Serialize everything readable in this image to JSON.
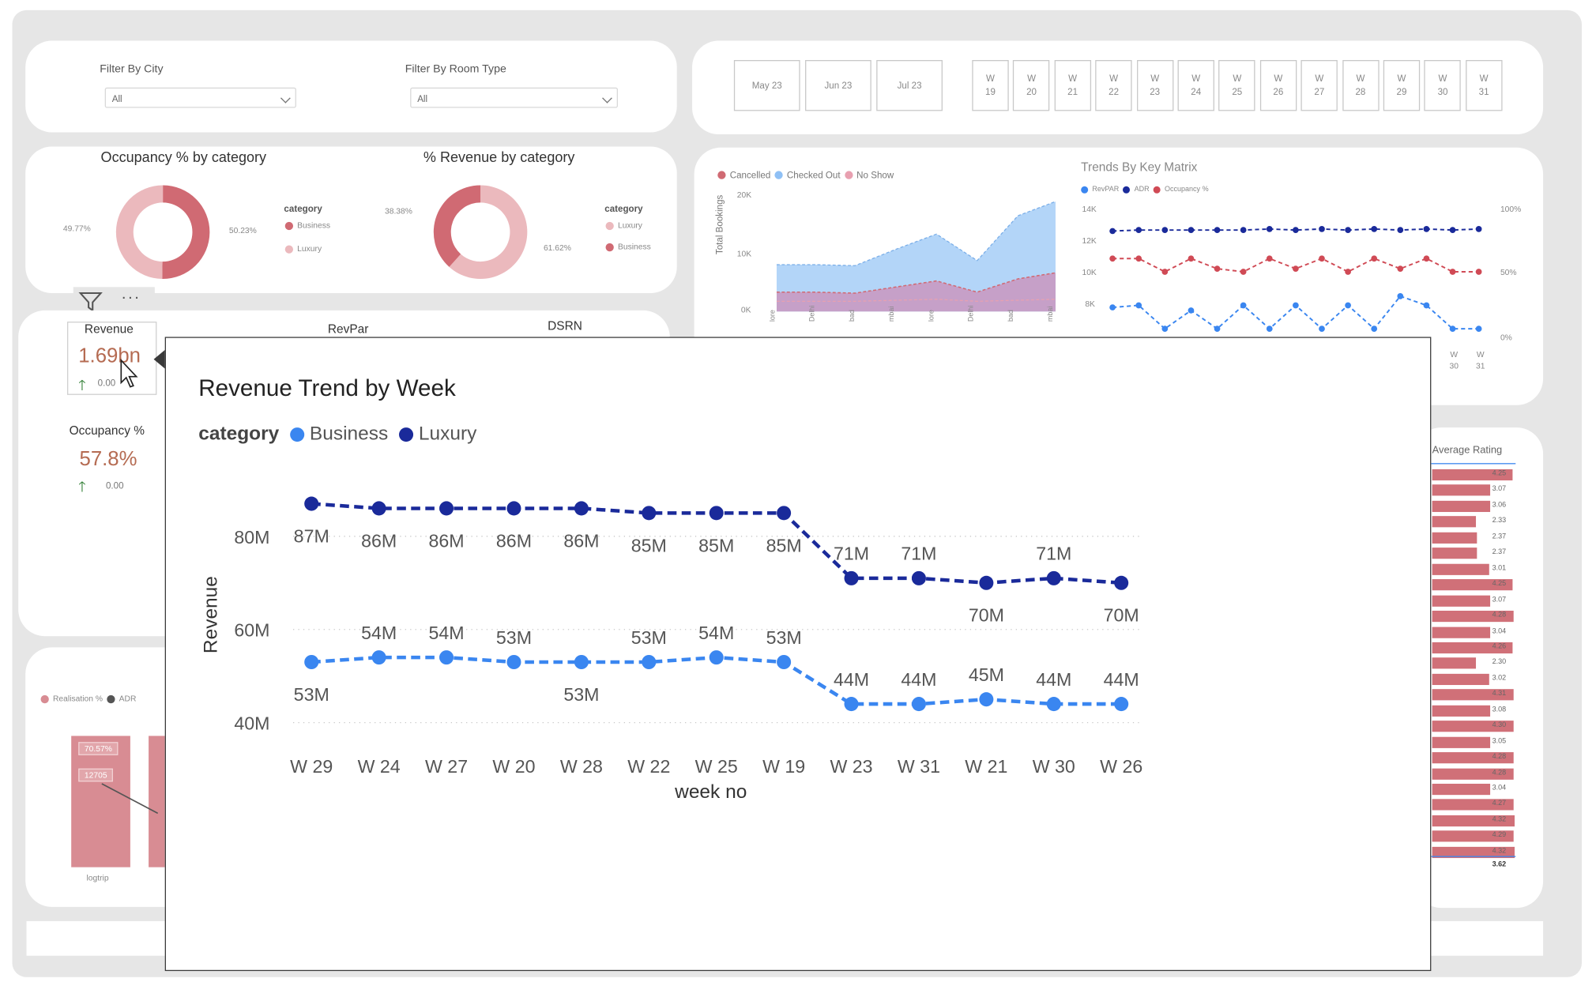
{
  "filters": {
    "city": {
      "label": "Filter By City",
      "value": "All"
    },
    "room_type": {
      "label": "Filter By Room Type",
      "value": "All"
    }
  },
  "date_slicer": {
    "months": [
      "May 23",
      "Jun 23",
      "Jul 23"
    ],
    "week_prefix": "W",
    "weeks": [
      "19",
      "20",
      "21",
      "22",
      "23",
      "24",
      "25",
      "26",
      "27",
      "28",
      "29",
      "30",
      "31"
    ]
  },
  "occupancy_donut": {
    "title": "Occupancy % by category",
    "legend_title": "category",
    "items": [
      {
        "name": "Business",
        "color": "#d06a73"
      },
      {
        "name": "Luxury",
        "color": "#ebb9bd"
      }
    ],
    "left_label": "49.77%",
    "right_label": "50.23%",
    "values": [
      50.23,
      49.77
    ]
  },
  "revenue_donut": {
    "title": "% Revenue by category",
    "legend_title": "category",
    "items": [
      {
        "name": "Luxury",
        "color": "#ebb9bd"
      },
      {
        "name": "Business",
        "color": "#d06a73"
      }
    ],
    "left_label": "38.38%",
    "right_label": "61.62%",
    "values": [
      61.62,
      38.38
    ]
  },
  "kpis": {
    "revenue": {
      "label": "Revenue",
      "value": "1.69bn",
      "delta": "0.00"
    },
    "revpar": {
      "label": "RevPar"
    },
    "dsrn": {
      "label": "DSRN"
    },
    "occupancy": {
      "label": "Occupancy %",
      "value": "57.8%",
      "delta": "0.00"
    }
  },
  "bookings_chart": {
    "legend": [
      {
        "name": "Cancelled",
        "color": "#d06a73"
      },
      {
        "name": "Checked Out",
        "color": "#8fc0f5"
      },
      {
        "name": "No Show",
        "color": "#e8a0b0"
      }
    ],
    "ylabel": "Total Bookings",
    "yticks": [
      "20K",
      "10K",
      "0K"
    ],
    "x_labels": [
      "lore",
      "Delhi",
      "bad",
      "mbai",
      "lore",
      "Delhi",
      "bad",
      "mbai"
    ]
  },
  "trends_chart": {
    "title": "Trends By Key Matrix",
    "legend": [
      {
        "name": "RevPAR",
        "color": "#3a86f0"
      },
      {
        "name": "ADR",
        "color": "#1a2a9a"
      },
      {
        "name": "Occupancy %",
        "color": "#d04a55"
      }
    ],
    "left_ticks": [
      "14K",
      "12K",
      "10K",
      "8K"
    ],
    "right_ticks": [
      "100%",
      "50%",
      "0%"
    ],
    "visible_weeks": [
      {
        "w": "W",
        "n": "30"
      },
      {
        "w": "W",
        "n": "31"
      }
    ]
  },
  "realisation_chart": {
    "legend": [
      {
        "name": "Realisation %",
        "color": "#d88c93"
      },
      {
        "name": "ADR",
        "color": "#555555"
      }
    ],
    "bar_label": "70.57%",
    "adr_label": "12705",
    "category": "logtrip"
  },
  "ratings": {
    "header": "Average Rating",
    "values": [
      "4.25",
      "3.07",
      "3.06",
      "2.33",
      "2.37",
      "2.37",
      "3.01",
      "4.25",
      "3.07",
      "4.28",
      "3.04",
      "4.26",
      "2.30",
      "3.02",
      "4.31",
      "3.08",
      "4.30",
      "3.05",
      "4.28",
      "4.28",
      "3.04",
      "4.27",
      "4.32",
      "4.29",
      "4.32"
    ],
    "total": "3.62"
  },
  "tooltip_chart": {
    "title": "Revenue Trend by Week",
    "legend_title": "category",
    "xlabel": "week no",
    "ylabel": "Revenue",
    "chart_data": {
      "type": "line",
      "title": "Revenue Trend by Week",
      "xlabel": "week no",
      "ylabel": "Revenue",
      "categories": [
        "W 29",
        "W 24",
        "W 27",
        "W 20",
        "W 28",
        "W 22",
        "W 25",
        "W 19",
        "W 23",
        "W 31",
        "W 21",
        "W 30",
        "W 26"
      ],
      "yticks": [
        {
          "v": 40,
          "label": "40M"
        },
        {
          "v": 60,
          "label": "60M"
        },
        {
          "v": 80,
          "label": "80M"
        }
      ],
      "ylim": [
        33,
        92
      ],
      "series": [
        {
          "name": "Business",
          "color": "#3a86f0",
          "values": [
            53,
            54,
            54,
            53,
            53,
            53,
            54,
            53,
            44,
            44,
            45,
            44,
            44
          ],
          "labels": [
            "53M",
            "54M",
            "54M",
            "53M",
            "53M",
            "53M",
            "54M",
            "53M",
            "44M",
            "44M",
            "45M",
            "44M",
            "44M"
          ],
          "label_pos": [
            "below",
            "above",
            "above",
            "above",
            "below",
            "above",
            "above",
            "above",
            "above",
            "above",
            "above",
            "above",
            "above"
          ]
        },
        {
          "name": "Luxury",
          "color": "#1a2a9a",
          "values": [
            87,
            86,
            86,
            86,
            86,
            85,
            85,
            85,
            71,
            71,
            70,
            71,
            70
          ],
          "labels": [
            "87M",
            "86M",
            "86M",
            "86M",
            "86M",
            "85M",
            "85M",
            "85M",
            "71M",
            "71M",
            "70M",
            "71M",
            "70M"
          ],
          "label_pos": [
            "below",
            "below",
            "below",
            "below",
            "below",
            "below",
            "below",
            "below",
            "above",
            "above",
            "below",
            "above",
            "below"
          ]
        }
      ]
    }
  }
}
